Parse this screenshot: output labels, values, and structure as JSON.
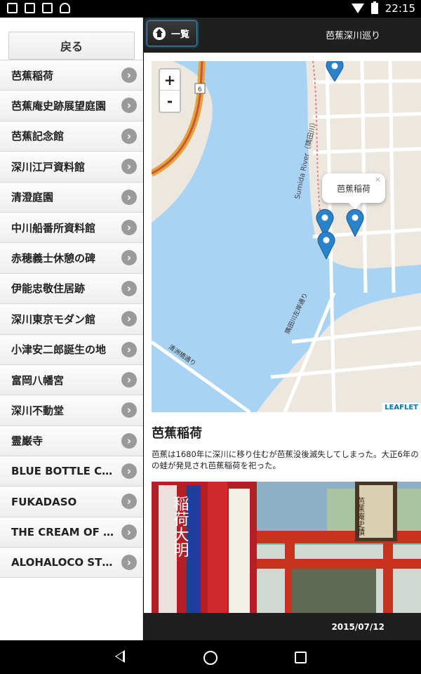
{
  "status": {
    "time": "22:15"
  },
  "sidebar": {
    "back_label": "戻る",
    "items": [
      {
        "label": "芭蕉稲荷"
      },
      {
        "label": "芭蕉庵史跡展望庭園"
      },
      {
        "label": "芭蕉記念館"
      },
      {
        "label": "深川江戸資料館"
      },
      {
        "label": "清澄庭園"
      },
      {
        "label": "中川船番所資料館"
      },
      {
        "label": "赤穂義士休憩の碑"
      },
      {
        "label": "伊能忠敬住居跡"
      },
      {
        "label": "深川東京モダン館"
      },
      {
        "label": "小津安二郎誕生の地"
      },
      {
        "label": "富岡八幡宮"
      },
      {
        "label": "深川不動堂"
      },
      {
        "label": "霊巌寺"
      },
      {
        "label": "BLUE BOTTLE COF..."
      },
      {
        "label": "FUKADASO"
      },
      {
        "label": "THE CREAM OF T..."
      },
      {
        "label": "ALOHALOCO STU..."
      }
    ]
  },
  "header": {
    "home_label": "一覧",
    "title": "芭蕉深川巡り"
  },
  "map": {
    "zoom_in": "+",
    "zoom_out": "-",
    "popup_text": "芭蕉稲荷",
    "popup_close": "×",
    "attribution": "LEAFLET",
    "labels": {
      "river": "Sumida River（隅田川）",
      "bridge": "清洲橋通り",
      "street": "隅田川左岸通り",
      "route": "6"
    }
  },
  "spot": {
    "title": "芭蕉稲荷",
    "description_line1": "芭蕉は1680年に深川に移り住むが芭蕉没後滅失してしまった。大正6年の",
    "description_line2": "の蛙が発見され芭蕉稲荷を祀った。",
    "photo_sign": "芭蕉庵史蹟",
    "photo_banner": "稲荷大明"
  },
  "footer": {
    "date": "2015/07/12"
  },
  "colors": {
    "water": "#a9d3f2",
    "land": "#ece8df",
    "marker": "#2a82cb",
    "highway": "#e8a23a"
  }
}
